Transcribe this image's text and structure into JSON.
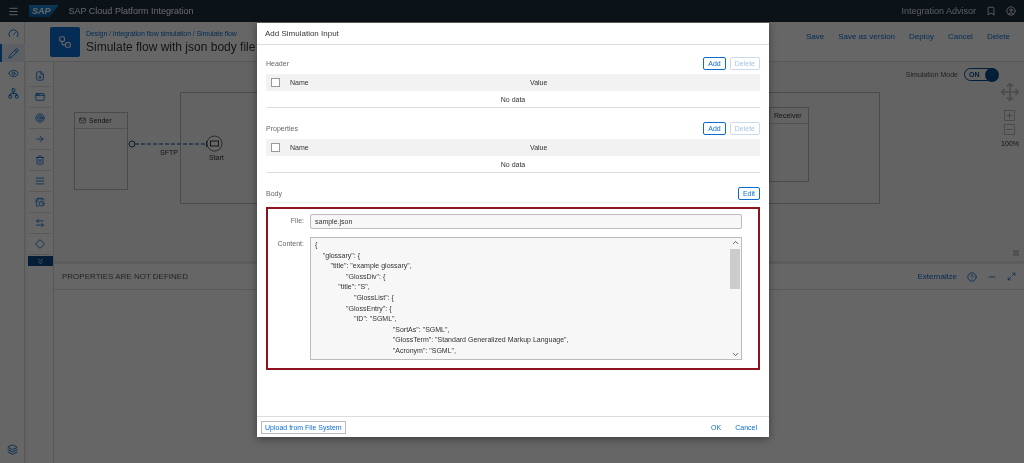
{
  "shell": {
    "logo": "SAP",
    "title": "SAP Cloud Platform Integration",
    "link": "Integration Advisor"
  },
  "nav": [
    {
      "selected": false
    },
    {
      "selected": true
    },
    {
      "selected": false
    },
    {
      "selected": false
    }
  ],
  "header": {
    "breadcrumb": "Design / Integration flow simulation / Simulate flow",
    "title": "Simulate flow with json body file",
    "actions": [
      "Save",
      "Save as version",
      "Deploy",
      "Cancel",
      "Delete"
    ]
  },
  "canvas": {
    "simulation_mode": {
      "label": "Simulation Mode",
      "text": "ON",
      "on": true
    },
    "zoom": "100%",
    "sender": "Sender",
    "channel": "SFTP",
    "start": "Start",
    "receiver": "Receiver"
  },
  "properties": {
    "message": "PROPERTIES ARE NOT DEFINED",
    "link": "Externalize"
  },
  "dialog": {
    "title": "Add Simulation Input",
    "sections": [
      {
        "title": "Header",
        "checked": false,
        "buttons": [
          {
            "label": "Add",
            "disabled": false
          },
          {
            "label": "Delete",
            "disabled": true
          }
        ],
        "columns": [
          "Name",
          "Value"
        ],
        "empty": "No data"
      },
      {
        "title": "Properties",
        "checked": false,
        "buttons": [
          {
            "label": "Add",
            "disabled": false
          },
          {
            "label": "Delete",
            "disabled": true
          }
        ],
        "columns": [
          "Name",
          "Value"
        ],
        "empty": "No data"
      }
    ],
    "body": {
      "title": "Body",
      "button": "Edit",
      "file_label": "File:",
      "file": "sample.json",
      "content_label": "Content:",
      "content": [
        "{",
        "    \"glossary\": {",
        "        \"title\": \"example glossary\",",
        "                \"GlossDiv\": {",
        "            \"title\": \"S\",",
        "                    \"GlossList\": {",
        "                \"GlossEntry\": {",
        "                    \"ID\": \"SGML\",",
        "                                        \"SortAs\": \"SGML\",",
        "                                        \"GlossTerm\": \"Standard Generalized Markup Language\",",
        "                                        \"Acronym\": \"SGML\","
      ]
    },
    "footer": {
      "upload": "Upload from File System",
      "ok": "OK",
      "cancel": "Cancel"
    }
  }
}
